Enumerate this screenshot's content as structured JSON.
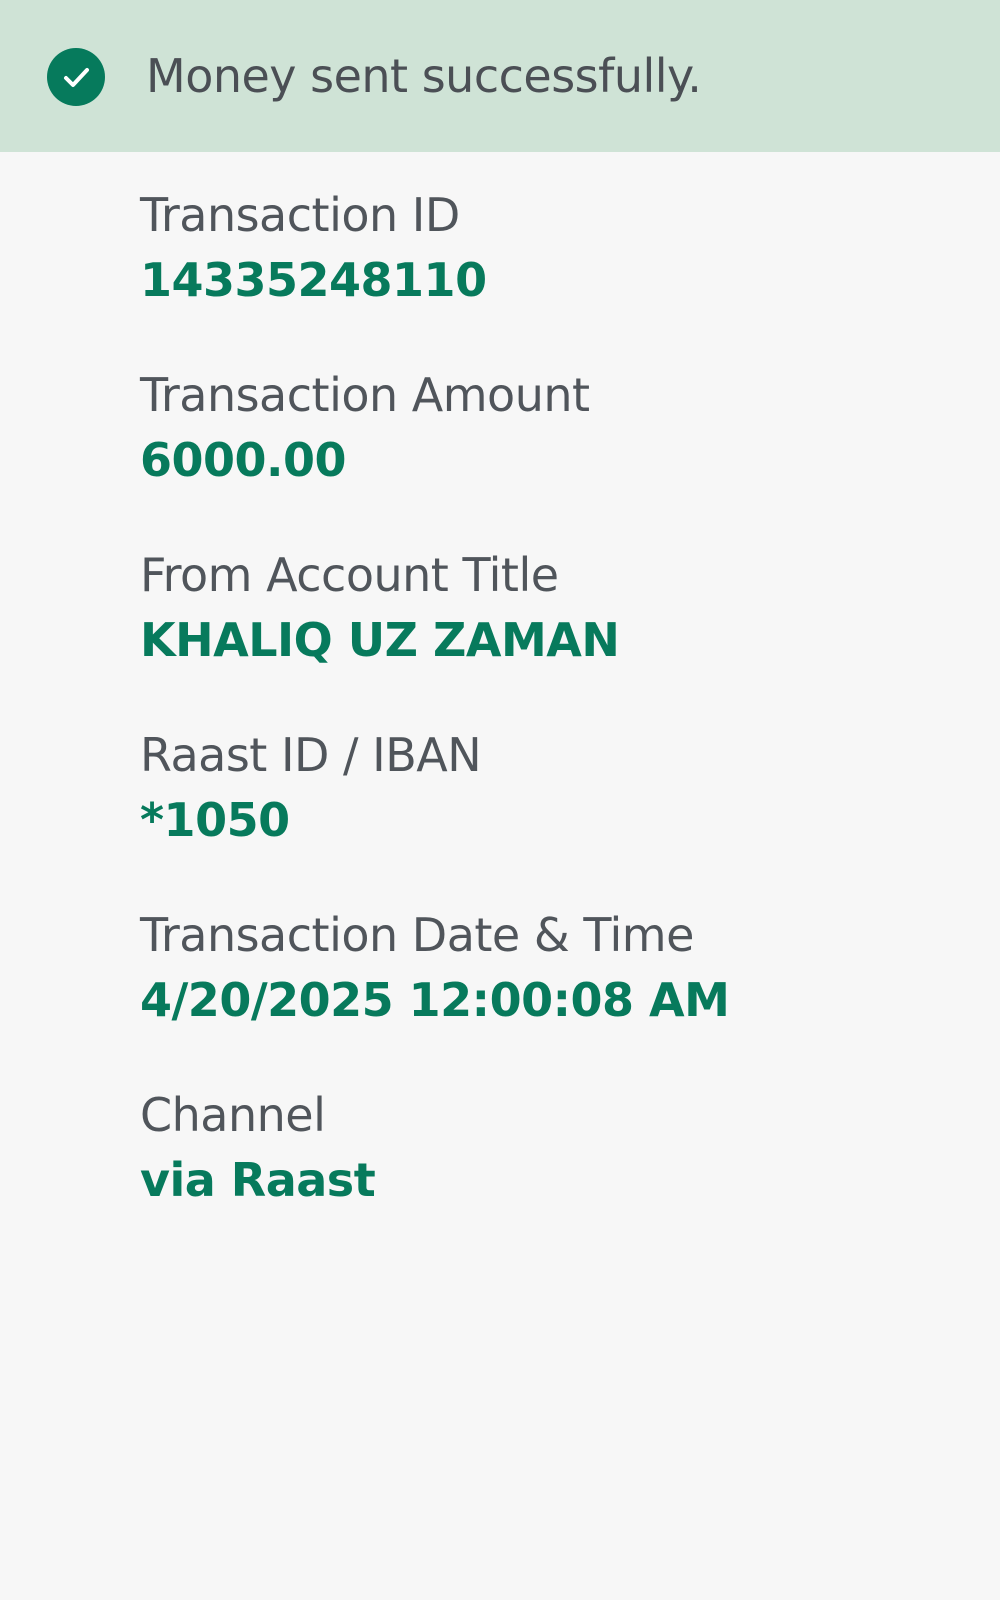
{
  "banner": {
    "icon": "check-circle-icon",
    "message": "Money sent successfully.",
    "background_color": "#cfe3d6",
    "icon_color": "#067a5c"
  },
  "details": [
    {
      "label": "Transaction ID",
      "value": "14335248110"
    },
    {
      "label": "Transaction Amount",
      "value": "6000.00"
    },
    {
      "label": "From Account Title",
      "value": "KHALIQ UZ ZAMAN"
    },
    {
      "label": "Raast ID / IBAN",
      "value": "*1050"
    },
    {
      "label": "Transaction Date & Time",
      "value": "4/20/2025 12:00:08 AM"
    },
    {
      "label": "Channel",
      "value": "via Raast"
    }
  ],
  "colors": {
    "label": "#50555b",
    "value": "#077a5c",
    "page_background": "#f7f7f7"
  }
}
